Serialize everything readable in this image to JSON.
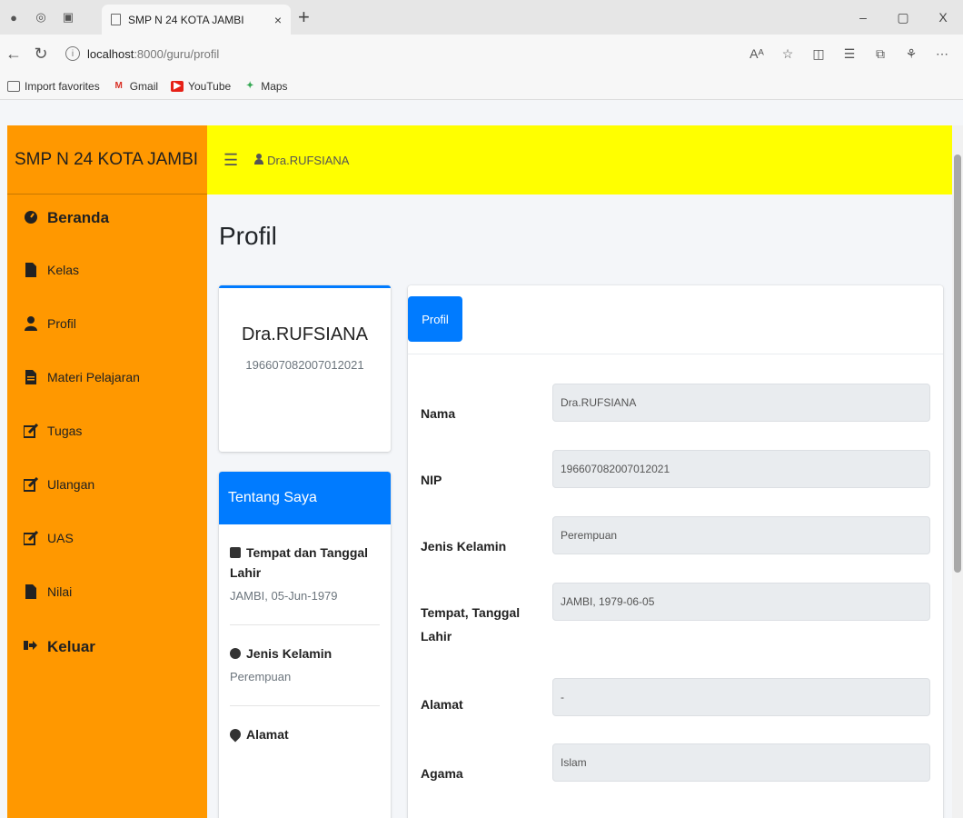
{
  "browser": {
    "tab_title": "SMP N 24 KOTA JAMBI",
    "tab_close": "×",
    "new_tab": "+",
    "url_host": "localhost",
    "url_path": ":8000/guru/profil",
    "window_controls": [
      "–",
      "▢",
      "X"
    ],
    "favorites": [
      "Import favorites",
      "Gmail",
      "YouTube",
      "Maps"
    ]
  },
  "sidebar": {
    "brand": "SMP N 24 KOTA JAMBI",
    "items": [
      {
        "label": "Beranda",
        "icon": "dashboard-icon"
      },
      {
        "label": "Kelas",
        "icon": "file-icon"
      },
      {
        "label": "Profil",
        "icon": "user-icon"
      },
      {
        "label": "Materi Pelajaran",
        "icon": "file-icon"
      },
      {
        "label": "Tugas",
        "icon": "edit-icon"
      },
      {
        "label": "Ulangan",
        "icon": "edit-icon"
      },
      {
        "label": "UAS",
        "icon": "edit-icon"
      },
      {
        "label": "Nilai",
        "icon": "file-icon"
      },
      {
        "label": "Keluar",
        "icon": "sign-out-icon"
      }
    ]
  },
  "topnav": {
    "user_name": "Dra.RUFSIANA"
  },
  "main": {
    "page_title": "Profil",
    "profile_card": {
      "name": "Dra.RUFSIANA",
      "nip": "196607082007012021"
    },
    "about": {
      "header": "Tentang Saya",
      "items": [
        {
          "label": "Tempat dan Tanggal Lahir",
          "value": "JAMBI, 05-Jun-1979",
          "icon": "book-icon"
        },
        {
          "label": "Jenis Kelamin",
          "value": "Perempuan",
          "icon": "gear-icon"
        },
        {
          "label": "Alamat",
          "value": "",
          "icon": "map-marker-icon"
        }
      ]
    },
    "form": {
      "tab_label": "Profil",
      "fields": [
        {
          "label": "Nama",
          "value": "Dra.RUFSIANA"
        },
        {
          "label": "NIP",
          "value": "196607082007012021"
        },
        {
          "label": "Jenis Kelamin",
          "value": "Perempuan"
        },
        {
          "label": "Tempat, Tanggal Lahir",
          "value": "JAMBI, 1979-06-05"
        },
        {
          "label": "Alamat",
          "value": "-"
        },
        {
          "label": "Agama",
          "value": "Islam"
        }
      ]
    }
  },
  "colors": {
    "sidebar_bg": "#ff9800",
    "topnav_bg": "#ffff00",
    "primary": "#007bff"
  }
}
